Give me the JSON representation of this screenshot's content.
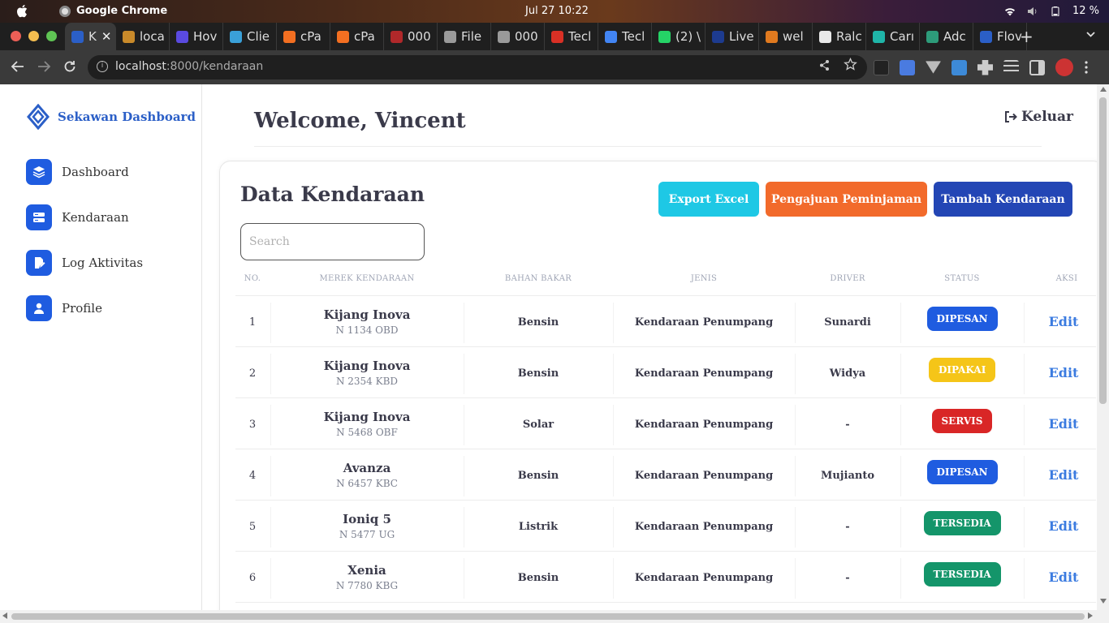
{
  "os": {
    "app_name": "Google Chrome",
    "clock": "Jul 27  10:22",
    "battery": "12 %"
  },
  "browser": {
    "tabs": [
      {
        "label": "K",
        "favicon_color": "#2b5fc7",
        "active": true
      },
      {
        "label": "loca",
        "favicon_color": "#c98a2a"
      },
      {
        "label": "Hov",
        "favicon_color": "#5a4ae0"
      },
      {
        "label": "Clie",
        "favicon_color": "#3aa0d8"
      },
      {
        "label": "cPa",
        "favicon_color": "#f36f21"
      },
      {
        "label": "cPa",
        "favicon_color": "#f36f21"
      },
      {
        "label": "000",
        "favicon_color": "#b0282a"
      },
      {
        "label": "File",
        "favicon_color": "#9a9a9a"
      },
      {
        "label": "000",
        "favicon_color": "#9a9a9a"
      },
      {
        "label": "Tecl",
        "favicon_color": "#d93025"
      },
      {
        "label": "Tecl",
        "favicon_color": "#4285f4"
      },
      {
        "label": "(2) \\",
        "favicon_color": "#25d366"
      },
      {
        "label": "Live",
        "favicon_color": "#1d3b8f"
      },
      {
        "label": "wel",
        "favicon_color": "#e07a1f"
      },
      {
        "label": "Ralc",
        "favicon_color": "#e8e8e8"
      },
      {
        "label": "Carı",
        "favicon_color": "#1fb5a8"
      },
      {
        "label": "Adc",
        "favicon_color": "#2d9c7a"
      },
      {
        "label": "Flov",
        "favicon_color": "#2b5fc7"
      }
    ],
    "new_tab_symbol": "+",
    "url_host": "localhost",
    "url_path": ":8000/kendaraan"
  },
  "sidebar": {
    "brand": "Sekawan Dashboard",
    "items": [
      {
        "label": "Dashboard",
        "icon": "layers-icon"
      },
      {
        "label": "Kendaraan",
        "icon": "server-icon"
      },
      {
        "label": "Log Aktivitas",
        "icon": "edit-file-icon"
      },
      {
        "label": "Profile",
        "icon": "user-icon"
      }
    ]
  },
  "header": {
    "welcome": "Welcome, Vincent",
    "logout_label": "Keluar"
  },
  "content": {
    "title": "Data Kendaraan",
    "buttons": {
      "export": "Export Excel",
      "pengajuan": "Pengajuan Peminjaman",
      "tambah": "Tambah Kendaraan"
    },
    "search_placeholder": "Search",
    "columns": [
      "NO.",
      "MEREK KENDARAAN",
      "BAHAN BAKAR",
      "JENIS",
      "DRIVER",
      "STATUS",
      "AKSI"
    ],
    "rows": [
      {
        "no": "1",
        "name": "Kijang Inova",
        "plate": "N 1134 OBD",
        "fuel": "Bensin",
        "jenis": "Kendaraan Penumpang",
        "driver": "Sunardi",
        "status": "DIPESAN",
        "status_color": "#1f5ce0",
        "action": "Edit"
      },
      {
        "no": "2",
        "name": "Kijang Inova",
        "plate": "N 2354 KBD",
        "fuel": "Bensin",
        "jenis": "Kendaraan Penumpang",
        "driver": "Widya",
        "status": "DIPAKAI",
        "status_color": "#f5c518",
        "action": "Edit"
      },
      {
        "no": "3",
        "name": "Kijang Inova",
        "plate": "N 5468 OBF",
        "fuel": "Solar",
        "jenis": "Kendaraan Penumpang",
        "driver": "-",
        "status": "SERVIS",
        "status_color": "#d92626",
        "action": "Edit"
      },
      {
        "no": "4",
        "name": "Avanza",
        "plate": "N 6457 KBC",
        "fuel": "Bensin",
        "jenis": "Kendaraan Penumpang",
        "driver": "Mujianto",
        "status": "DIPESAN",
        "status_color": "#1f5ce0",
        "action": "Edit"
      },
      {
        "no": "5",
        "name": "Ioniq 5",
        "plate": "N 5477 UG",
        "fuel": "Listrik",
        "jenis": "Kendaraan Penumpang",
        "driver": "-",
        "status": "TERSEDIA",
        "status_color": "#14956a",
        "action": "Edit"
      },
      {
        "no": "6",
        "name": "Xenia",
        "plate": "N 7780 KBG",
        "fuel": "Bensin",
        "jenis": "Kendaraan Penumpang",
        "driver": "-",
        "status": "TERSEDIA",
        "status_color": "#14956a",
        "action": "Edit"
      }
    ]
  }
}
